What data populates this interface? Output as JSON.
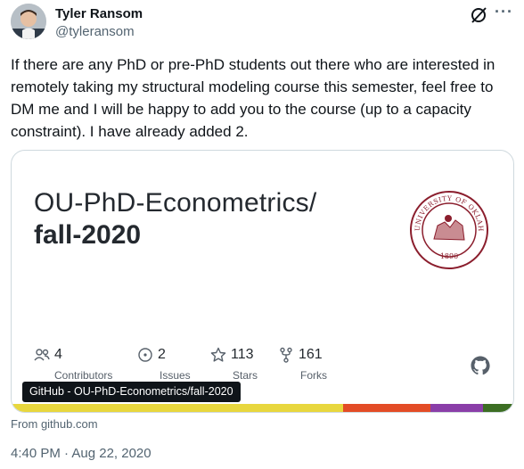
{
  "author": {
    "name": "Tyler Ransom",
    "handle": "@tyleransom",
    "avatar_icon": "profile-photo"
  },
  "tweet": {
    "text": "If there are any PhD or pre-PhD students out there who are interested in remotely taking my structural modeling course this semester, feel free to DM me and I will be happy to add you to the course (up to a capacity constraint). I have already added 2.",
    "timestamp": "4:40 PM · Aug 22, 2020"
  },
  "card": {
    "repo_owner": "OU-PhD-Econometrics/",
    "repo_name": "fall-2020",
    "seal_text_top": "THE UNIVERSITY OF OKLAHOMA",
    "seal_year": "1890",
    "stats": [
      {
        "icon": "people-icon",
        "value": "4",
        "label": "Contributors"
      },
      {
        "icon": "issue-icon",
        "value": "2",
        "label": "Issues"
      },
      {
        "icon": "star-icon",
        "value": "113",
        "label": "Stars"
      },
      {
        "icon": "fork-icon",
        "value": "161",
        "label": "Forks"
      }
    ],
    "tooltip": "GitHub - OU-PhD-Econometrics/fall-2020",
    "source": "From github.com",
    "language_colors": [
      "#e8d73e",
      "#e34c26",
      "#8a3ea8",
      "#3c6e23"
    ],
    "language_fractions": [
      0.66,
      0.175,
      0.105,
      0.06
    ]
  },
  "colors": {
    "seal": "#8b1e2d",
    "text": "#0f1419",
    "muted": "#536471"
  }
}
